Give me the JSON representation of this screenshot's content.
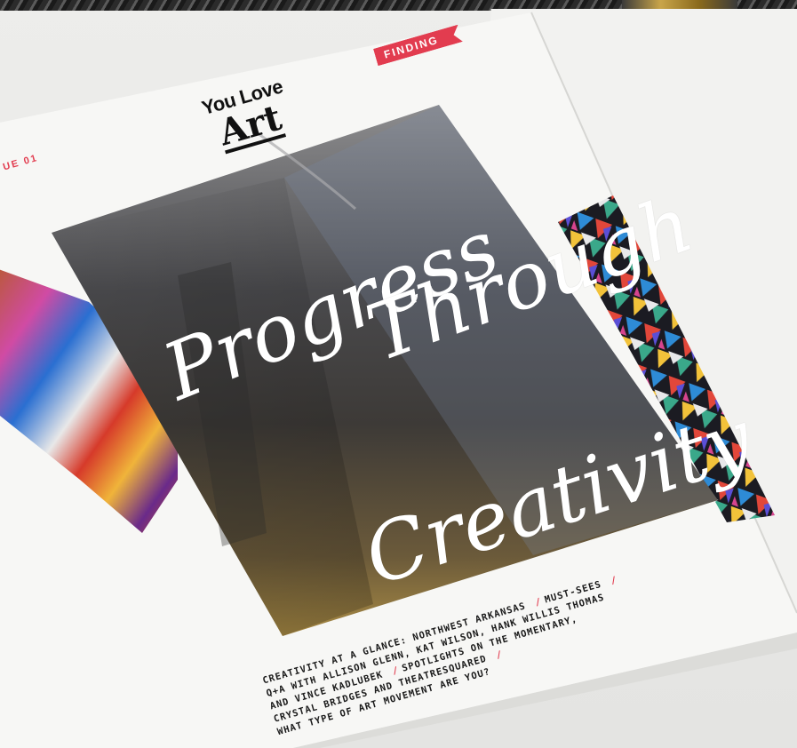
{
  "magazine": {
    "finding_tag": "FINDING",
    "issue_label": "UE 01",
    "masthead_small": "You Love",
    "masthead_big": "Art",
    "headline_line_1": "Progress",
    "headline_line_2": "Through",
    "headline_line_3": "Creativity",
    "contents_lines": [
      [
        "CREATIVITY AT A GLANCE: NORTHWEST ARKANSAS",
        "/",
        "MUST-SEES",
        "/"
      ],
      [
        "Q+A WITH ALLISON GLENN, KAT WILSON, HANK WILLIS THOMAS"
      ],
      [
        "AND VINCE KADLUBEK",
        "/",
        "SPOTLIGHTS ON THE MOMENTARY,"
      ],
      [
        "CRYSTAL BRIDGES AND THEATRESQUARED",
        "/"
      ],
      [
        "WHAT TYPE OF ART MOVEMENT ARE YOU?"
      ]
    ]
  },
  "colors": {
    "accent_red": "#e23c4f",
    "cover_paper": "#f7f7f5",
    "ink": "#111111"
  }
}
